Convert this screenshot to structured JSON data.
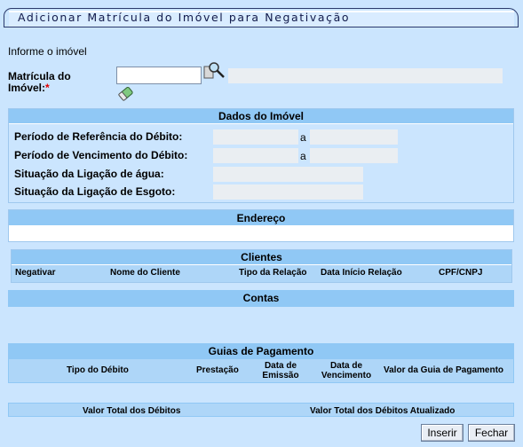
{
  "window": {
    "title": "Adicionar Matrícula do Imóvel para Negativação"
  },
  "form": {
    "info_label": "Informe o imóvel",
    "matricula_label_line1": "Matrícula do",
    "matricula_label_line2": "Imóvel:",
    "required_mark": "*",
    "matricula_value": "",
    "descricao_value": ""
  },
  "dados_imovel": {
    "header": "Dados do Imóvel",
    "periodo_referencia_label": "Período de Referência do Débito:",
    "periodo_vencimento_label": "Período de Vencimento do Débito:",
    "range_sep": "a",
    "situacao_agua_label": "Situação da Ligação de água:",
    "situacao_esgoto_label": "Situação da Ligação de Esgoto:",
    "ref_inicio": "",
    "ref_fim": "",
    "venc_inicio": "",
    "venc_fim": "",
    "agua_value": "",
    "esgoto_value": ""
  },
  "endereco": {
    "header": "Endereço",
    "value": ""
  },
  "clientes": {
    "header": "Clientes",
    "columns": [
      "Negativar",
      "Nome do Cliente",
      "Tipo da Relação",
      "Data Início Relação",
      "CPF/CNPJ"
    ]
  },
  "contas": {
    "header": "Contas"
  },
  "guias": {
    "header": "Guias de Pagamento",
    "columns": [
      "Tipo do Débito",
      "Prestação",
      "Data de\nEmissão",
      "Data de\nVencimento",
      "Valor da Guia de Pagamento"
    ]
  },
  "totais": {
    "valor_total": "Valor Total dos Débitos",
    "valor_total_atualizado": "Valor Total dos Débitos Atualizado"
  },
  "buttons": {
    "inserir": "Inserir",
    "fechar": "Fechar"
  },
  "icons": [
    "search-icon",
    "eraser-icon"
  ]
}
